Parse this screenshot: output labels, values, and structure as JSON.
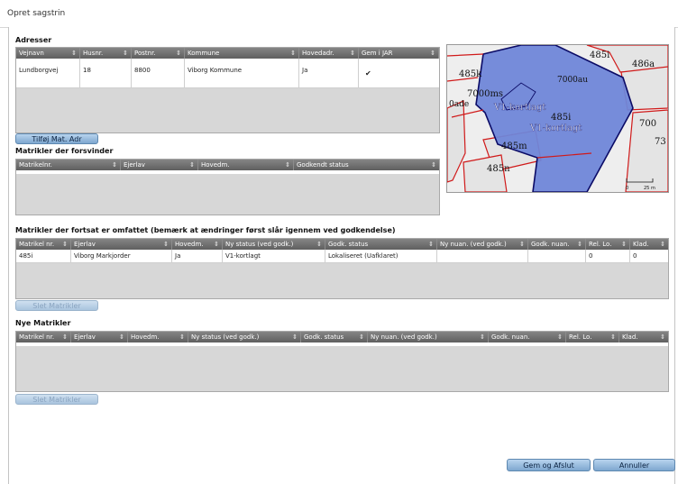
{
  "window": {
    "title": "Opret sagstrin"
  },
  "adresser": {
    "title": "Adresser",
    "columns": [
      "Vejnavn",
      "Husnr.",
      "Postnr.",
      "Kommune",
      "Hovedadr.",
      "Gem i JAR"
    ],
    "rows": [
      {
        "vejnavn": "Lundborgvej",
        "husnr": "18",
        "postnr": "8800",
        "kommune": "Viborg Kommune",
        "hovedadr": "Ja",
        "gem_i_jar": true
      }
    ],
    "add_button": "Tilføj Mat. Adr"
  },
  "forsvinder": {
    "title": "Matrikler der forsvinder",
    "columns": [
      "Matrikelnr.",
      "Ejerlav",
      "Hovedm.",
      "Godkendt status"
    ]
  },
  "fortsat": {
    "title": "Matrikler der fortsat er omfattet (bemærk at ændringer først slår igennem ved godkendelse)",
    "columns": [
      "Matrikel nr.",
      "Ejerlav",
      "Hovedm.",
      "Ny status (ved godk.)",
      "Godk. status",
      "Ny nuan. (ved godk.)",
      "Godk. nuan.",
      "Rel. Lo.",
      "Klad."
    ],
    "rows": [
      {
        "matrikel": "485i",
        "ejerlav": "Viborg Markjorder",
        "hovedm": "Ja",
        "ny_status": "V1-kortlagt",
        "godk_status": "Lokaliseret (Uafklaret)",
        "ny_nuan": "",
        "godk_nuan": "",
        "rel_lo": "0",
        "klad": "0"
      }
    ],
    "delete_button": "Slet Matrikler"
  },
  "nye": {
    "title": "Nye Matrikler",
    "columns": [
      "Matrikel nr.",
      "Ejerlav",
      "Hovedm.",
      "Ny status (ved godk.)",
      "Godk. status",
      "Ny nuan. (ved godk.)",
      "Godk. nuan.",
      "Rel. Lo.",
      "Klad."
    ],
    "delete_button": "Slet Matrikler"
  },
  "map": {
    "labels": [
      "485i",
      "486a",
      "485k",
      "7000au",
      "7000ms",
      "V1-kortlagt",
      "485i",
      "V1-kortlagt",
      "700",
      "485m",
      "73",
      "485n",
      "0ade"
    ],
    "scale": {
      "left": "0",
      "right": "25 m"
    },
    "colors": {
      "area_fill": "#6f86d8",
      "parcel_line": "#d01a1a",
      "background": "#eeeeee"
    }
  },
  "footer": {
    "save_button": "Gem og Afslut",
    "cancel_button": "Annuller"
  },
  "colors": {
    "grid_header": "#6f6f6f",
    "button": "#8fb4da",
    "accent_text": "#0c2342"
  }
}
